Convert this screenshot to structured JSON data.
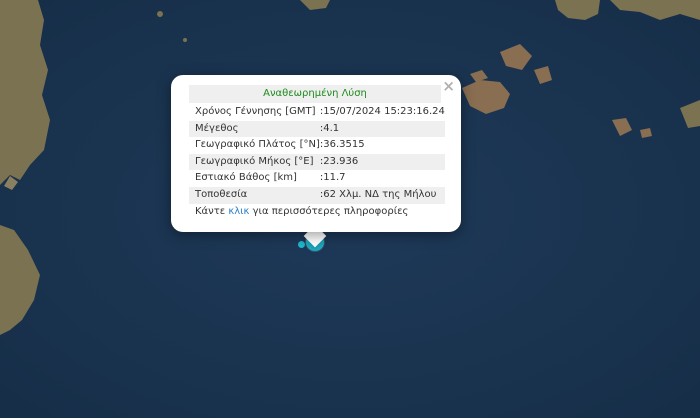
{
  "map": {
    "marker_icon": "earthquake-circle-marker",
    "ocean_color": "#1b3552",
    "land_color": "#8a7f5f"
  },
  "popup": {
    "title": "Αναθεωρημένη Λύση",
    "close_symbol": "×",
    "rows": [
      {
        "key": "Χρόνος Γέννησης [GMT]",
        "sep": ":",
        "value": "15/07/2024 15:23:16.24"
      },
      {
        "key": "Μέγεθος",
        "sep": ":",
        "value": "4.1"
      },
      {
        "key": "Γεωγραφικό Πλάτος [°N]",
        "sep": ":",
        "value": "36.3515"
      },
      {
        "key": "Γεωγραφικό Μήκος [°E]",
        "sep": ":",
        "value": "23.936"
      },
      {
        "key": "Εστιακό Βάθος [km]",
        "sep": ":",
        "value": "11.7"
      },
      {
        "key": "Τοποθεσία",
        "sep": ":",
        "value": "62 Χλμ. ΝΔ της Μήλου"
      }
    ],
    "more_prefix": "Κάντε",
    "more_link": "κλικ",
    "more_suffix": "για περισσότερες πληροφορίες"
  }
}
